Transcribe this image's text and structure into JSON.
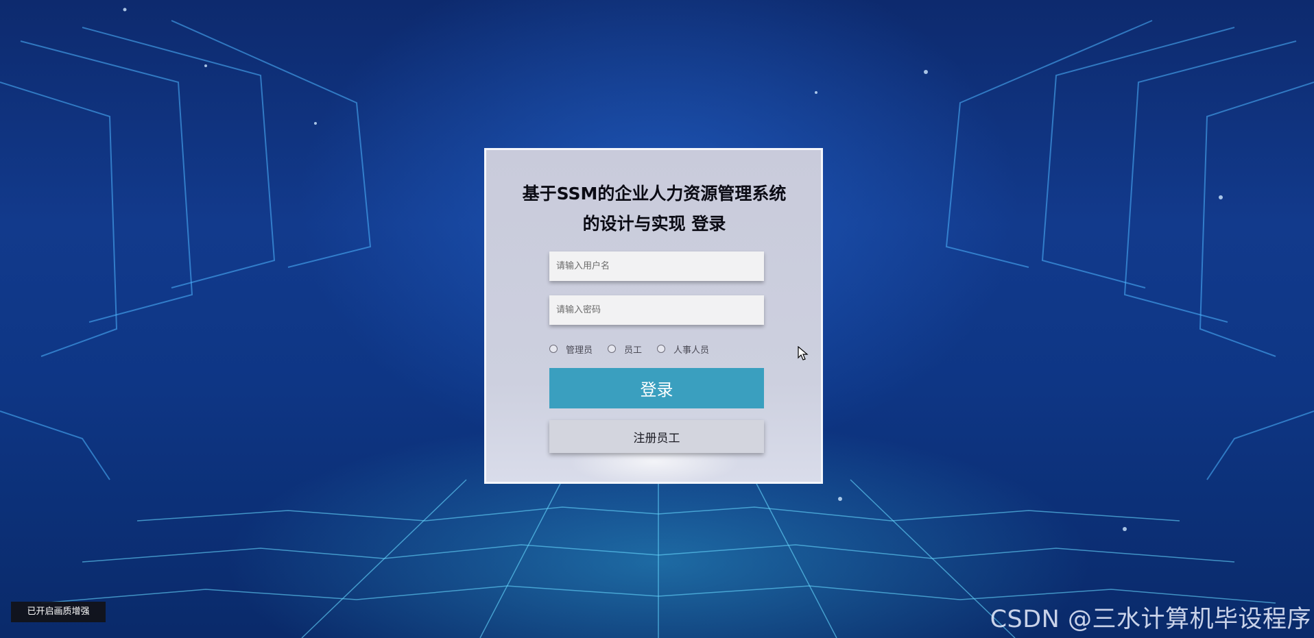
{
  "login": {
    "title": "基于SSM的企业人力资源管理系统的设计与实现 登录",
    "username_placeholder": "请输入用户名",
    "password_placeholder": "请输入密码",
    "roles": [
      {
        "label": "管理员"
      },
      {
        "label": "员工"
      },
      {
        "label": "人事人员"
      }
    ],
    "login_label": "登录",
    "register_label": "注册员工"
  },
  "overlay": {
    "enhance_badge": "已开启画质增强",
    "watermark": "CSDN @三水计算机毕设程序"
  },
  "colors": {
    "login_button": "#3a9fbf",
    "card_bg": "#cdd0df",
    "background": "#123a8c"
  },
  "icons": {
    "cursor": "mouse-pointer-icon"
  }
}
